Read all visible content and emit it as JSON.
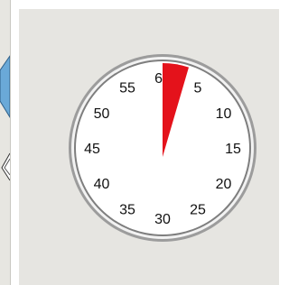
{
  "timer": {
    "dial_numbers": [
      "60",
      "5",
      "10",
      "15",
      "20",
      "25",
      "30",
      "35",
      "40",
      "45",
      "50",
      "55"
    ],
    "set_minutes": 3,
    "colors": {
      "wedge": "#e4121b",
      "panel": "#e6e5e1",
      "bezel": "#8a8a8a",
      "face": "#ffffff"
    }
  },
  "left_strip": {
    "icon": "blue-arrow-icon",
    "accent": "#6aa9d8"
  }
}
